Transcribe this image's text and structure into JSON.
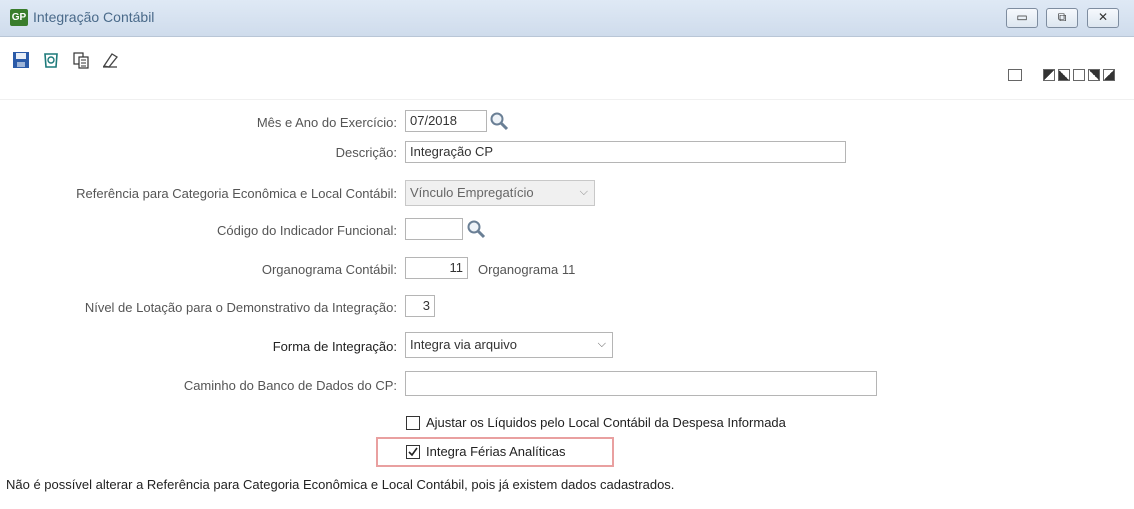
{
  "window": {
    "app_icon_text": "GP",
    "title": "Integração Contábil",
    "controls": {
      "minimize": "▭",
      "restore": "⧉",
      "close": "✕"
    }
  },
  "toolbar": {
    "icons": [
      "save-icon",
      "delete-icon",
      "copy-icon",
      "clear-icon"
    ],
    "right_icons": [
      "print-icon",
      "layout-top-left-icon",
      "layout-bottom-left-icon",
      "layout-center-icon",
      "layout-top-right-icon",
      "layout-bottom-right-icon"
    ]
  },
  "form": {
    "mes_ano": {
      "label": "Mês e Ano do Exercício:",
      "value": "07/2018"
    },
    "descricao": {
      "label": "Descrição:",
      "value": "Integração CP"
    },
    "referencia": {
      "label": "Referência para Categoria Econômica e Local Contábil:",
      "value": "Vínculo Empregatício"
    },
    "codigo_indicador": {
      "label": "Código do Indicador Funcional:",
      "value": ""
    },
    "organograma": {
      "label": "Organograma Contábil:",
      "value": "11",
      "description": "Organograma 11"
    },
    "nivel_lotacao": {
      "label": "Nível de Lotação para o Demonstrativo da Integração:",
      "value": "3"
    },
    "forma_integracao": {
      "label": "Forma de Integração:",
      "value": "Integra via arquivo"
    },
    "caminho_banco": {
      "label": "Caminho do Banco de Dados do CP:",
      "value": ""
    },
    "checkbox_ajustar": {
      "label": "Ajustar os Líquidos pelo Local Contábil da Despesa Informada",
      "checked": false
    },
    "checkbox_ferias": {
      "label": "Integra Férias Analíticas",
      "checked": true
    }
  },
  "note": "Não é possível alterar a Referência para Categoria Econômica e Local Contábil, pois já existem dados cadastrados.",
  "colors": {
    "highlight": "#e9a0a0",
    "titlebar": "#d6e2f0"
  }
}
